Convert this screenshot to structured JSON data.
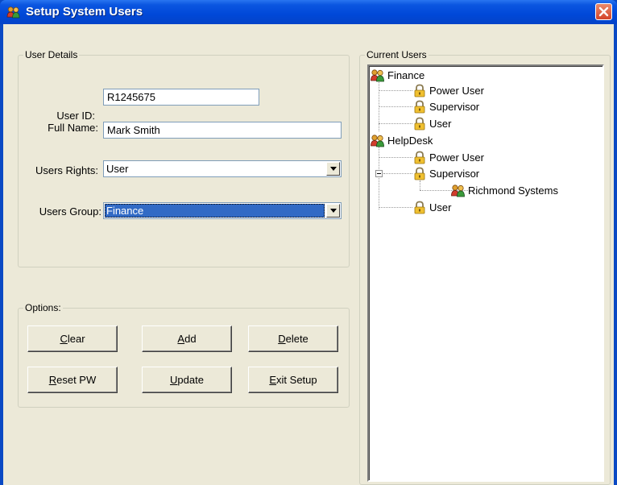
{
  "window": {
    "title": "Setup System Users",
    "close_icon": "close-icon",
    "app_icon": "users-icon"
  },
  "user_details": {
    "legend": "User Details",
    "user_id_label": "User ID:",
    "user_id_value": "R1245675",
    "full_name_label": "Full Name:",
    "full_name_value": "Mark Smith",
    "rights_label": "Users Rights:",
    "rights_value": "User",
    "group_label": "Users Group:",
    "group_value": "Finance"
  },
  "options": {
    "legend": "Options:",
    "buttons": {
      "clear": {
        "mnemonic": "C",
        "rest": "lear"
      },
      "add": {
        "mnemonic": "A",
        "rest": "dd"
      },
      "delete": {
        "mnemonic": "D",
        "rest": "elete"
      },
      "reset": {
        "mnemonic": "R",
        "rest": "eset PW"
      },
      "update": {
        "mnemonic": "U",
        "rest": "pdate"
      },
      "exit": {
        "mnemonic": "E",
        "rest": "xit Setup"
      }
    }
  },
  "current_users": {
    "legend": "Current Users",
    "tree": [
      {
        "label": "Finance",
        "type": "group",
        "children": [
          {
            "label": "Power User",
            "type": "right"
          },
          {
            "label": "Supervisor",
            "type": "right"
          },
          {
            "label": "User",
            "type": "right"
          }
        ]
      },
      {
        "label": "HelpDesk",
        "type": "group",
        "children": [
          {
            "label": "Power User",
            "type": "right"
          },
          {
            "label": "Supervisor",
            "type": "right",
            "expanded": true,
            "children": [
              {
                "label": "Richmond Systems",
                "type": "group"
              }
            ]
          },
          {
            "label": "User",
            "type": "right"
          }
        ]
      }
    ]
  },
  "colors": {
    "titlebar": "#0b56e0",
    "dialog_bg": "#ece9d8",
    "selection": "#316ac5",
    "close": "#d4442a"
  }
}
